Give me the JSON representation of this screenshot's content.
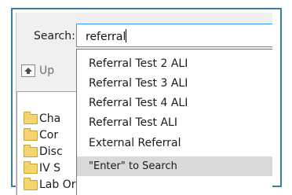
{
  "search": {
    "label": "Search:",
    "value": "referral"
  },
  "toolbar": {
    "up_label": "Up",
    "up_icon": "up-arrow-icon"
  },
  "tree": {
    "items": [
      {
        "label": "Cha",
        "icon": "folder-icon"
      },
      {
        "label": "Cor",
        "icon": "folder-icon"
      },
      {
        "label": "Disc",
        "icon": "folder-icon"
      },
      {
        "label": "IV S",
        "icon": "folder-icon"
      },
      {
        "label": "Lab Orders",
        "icon": "folder-icon"
      }
    ]
  },
  "dropdown": {
    "items": [
      "Referral Test 2 ALI",
      "Referral Test 3 ALI",
      "Referral Test 4 ALI",
      "Referral Test ALI",
      "External Referral"
    ],
    "hint": "\"Enter\" to Search"
  },
  "colors": {
    "frame_border": "#3c7f9b",
    "input_focus_border": "#3399ff",
    "hint_background": "#d9d9d9"
  }
}
